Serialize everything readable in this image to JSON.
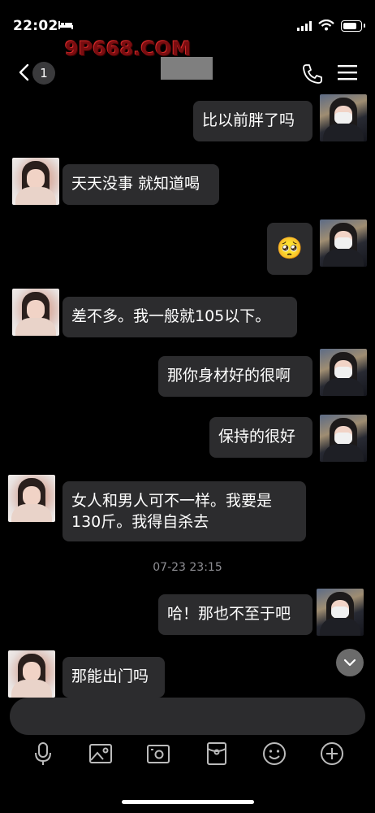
{
  "status_bar": {
    "time": "22:02",
    "watermark": "9P668.COM"
  },
  "header": {
    "unread_count": "1"
  },
  "messages": [
    {
      "side": "right",
      "text": "比以前胖了吗"
    },
    {
      "side": "left",
      "text": "天天没事 就知道喝"
    },
    {
      "side": "right",
      "text": "🥺"
    },
    {
      "side": "left",
      "text": "差不多。我一般就105以下。"
    },
    {
      "side": "right",
      "text": "那你身材好的很啊"
    },
    {
      "side": "right",
      "text": "保持的很好"
    },
    {
      "side": "left",
      "text": "女人和男人可不一样。我要是130斤。我得自杀去"
    },
    {
      "side": "right",
      "text": "哈！那也不至于吧"
    },
    {
      "side": "left",
      "text": "那能出门吗"
    }
  ],
  "divider": {
    "timestamp": "07-23 23:15"
  },
  "input": {
    "placeholder": ""
  },
  "toolbar": [
    "microphone-icon",
    "image-icon",
    "camera-icon",
    "red-packet-icon",
    "emoji-icon",
    "plus-icon"
  ],
  "colors": {
    "bubble": "#2c2c2e",
    "background": "#000000"
  }
}
